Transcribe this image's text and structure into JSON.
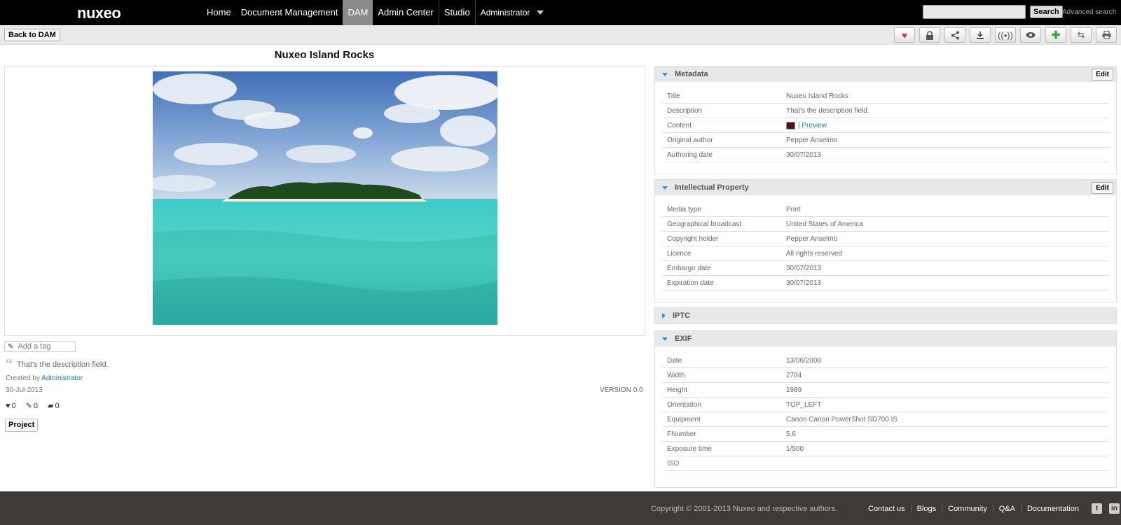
{
  "app": {
    "logo": "nuxeo",
    "nav": [
      "Home",
      "Document Management",
      "DAM",
      "Admin Center",
      "Studio"
    ],
    "user": "Administrator",
    "search_button": "Search",
    "advanced_search": "Advanced search",
    "accent_color": "#2a9ad6"
  },
  "actionbar": {
    "back_label": "Back to DAM",
    "icons": [
      "heart-icon",
      "lock-icon",
      "share-icon",
      "download-icon",
      "broadcast-icon",
      "eye-icon",
      "plus-icon",
      "swap-icon",
      "print-icon"
    ]
  },
  "document": {
    "title": "Nuxeo Island Rocks",
    "tag_placeholder": "Add a tag",
    "description": "That's the description field.",
    "created_by_prefix": "Created by",
    "created_by": "Administrator",
    "date": "30-Jul-2013",
    "version": "VERSION 0.0",
    "likes": "0",
    "edits": "0",
    "comments": "0",
    "project_label": "Project"
  },
  "metadata": {
    "title": "Metadata",
    "edit": "Edit",
    "rows": [
      {
        "label": "Title",
        "value": "Nuxeo Island Rocks"
      },
      {
        "label": "Description",
        "value": "That's the description field."
      },
      {
        "label": "Content",
        "value": "| Preview"
      },
      {
        "label": "Original author",
        "value": "Pepper Anselmo"
      },
      {
        "label": "Authoring date",
        "value": "30/07/2013"
      }
    ]
  },
  "ip": {
    "title": "Intellectual Property",
    "edit": "Edit",
    "rows": [
      {
        "label": "Media type",
        "value": "Print"
      },
      {
        "label": "Geographical broadcast",
        "value": "United States of America"
      },
      {
        "label": "Copyright holder",
        "value": "Pepper Anselmo"
      },
      {
        "label": "Licence",
        "value": "All rights reserved"
      },
      {
        "label": "Embargo date",
        "value": "30/07/2013"
      },
      {
        "label": "Expiration date",
        "value": "30/07/2013"
      }
    ]
  },
  "iptc": {
    "title": "IPTC"
  },
  "exif": {
    "title": "EXIF",
    "rows": [
      {
        "label": "Date",
        "value": "13/06/2008"
      },
      {
        "label": "Width",
        "value": "2704"
      },
      {
        "label": "Height",
        "value": "1989"
      },
      {
        "label": "Orientation",
        "value": "TOP_LEFT"
      },
      {
        "label": "Equipment",
        "value": "Canon Canon PowerShot SD700 IS"
      },
      {
        "label": "FNumber",
        "value": "5.6"
      },
      {
        "label": "Exposure time",
        "value": "1/500"
      },
      {
        "label": "ISO",
        "value": ""
      }
    ]
  },
  "footer": {
    "copyright": "Copyright © 2001-2013 Nuxeo and respective authors.",
    "links": [
      "Contact us",
      "Blogs",
      "Community",
      "Q&A",
      "Documentation"
    ]
  }
}
